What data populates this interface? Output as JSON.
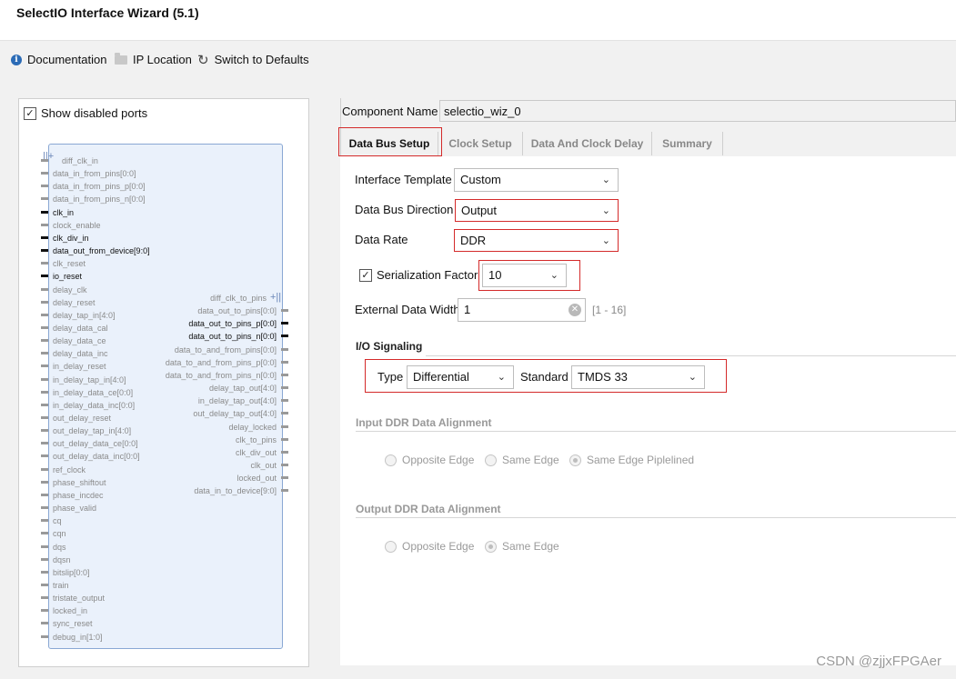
{
  "window": {
    "title": "SelectIO Interface Wizard (5.1)"
  },
  "toolbar": {
    "documentation": "Documentation",
    "ip_location": "IP Location",
    "switch_defaults": "Switch to Defaults"
  },
  "left": {
    "show_disabled_ports": "Show disabled ports",
    "left_pins": [
      {
        "label": "diff_clk_in",
        "active": false
      },
      {
        "label": "data_in_from_pins[0:0]",
        "active": false
      },
      {
        "label": "data_in_from_pins_p[0:0]",
        "active": false
      },
      {
        "label": "data_in_from_pins_n[0:0]",
        "active": false
      },
      {
        "label": "clk_in",
        "active": true
      },
      {
        "label": "clock_enable",
        "active": false
      },
      {
        "label": "clk_div_in",
        "active": true
      },
      {
        "label": "data_out_from_device[9:0]",
        "active": true
      },
      {
        "label": "clk_reset",
        "active": false
      },
      {
        "label": "io_reset",
        "active": true
      },
      {
        "label": "delay_clk",
        "active": false
      },
      {
        "label": "delay_reset",
        "active": false
      },
      {
        "label": "delay_tap_in[4:0]",
        "active": false
      },
      {
        "label": "delay_data_cal",
        "active": false
      },
      {
        "label": "delay_data_ce",
        "active": false
      },
      {
        "label": "delay_data_inc",
        "active": false
      },
      {
        "label": "in_delay_reset",
        "active": false
      },
      {
        "label": "in_delay_tap_in[4:0]",
        "active": false
      },
      {
        "label": "in_delay_data_ce[0:0]",
        "active": false
      },
      {
        "label": "in_delay_data_inc[0:0]",
        "active": false
      },
      {
        "label": "out_delay_reset",
        "active": false
      },
      {
        "label": "out_delay_tap_in[4:0]",
        "active": false
      },
      {
        "label": "out_delay_data_ce[0:0]",
        "active": false
      },
      {
        "label": "out_delay_data_inc[0:0]",
        "active": false
      },
      {
        "label": "ref_clock",
        "active": false
      },
      {
        "label": "phase_shiftout",
        "active": false
      },
      {
        "label": "phase_incdec",
        "active": false
      },
      {
        "label": "phase_valid",
        "active": false
      },
      {
        "label": "cq",
        "active": false
      },
      {
        "label": "cqn",
        "active": false
      },
      {
        "label": "dqs",
        "active": false
      },
      {
        "label": "dqsn",
        "active": false
      },
      {
        "label": "bitslip[0:0]",
        "active": false
      },
      {
        "label": "train",
        "active": false
      },
      {
        "label": "tristate_output",
        "active": false
      },
      {
        "label": "locked_in",
        "active": false
      },
      {
        "label": "sync_reset",
        "active": false
      },
      {
        "label": "debug_in[1:0]",
        "active": false
      }
    ],
    "right_pins": [
      {
        "label": "diff_clk_to_pins",
        "active": false
      },
      {
        "label": "data_out_to_pins[0:0]",
        "active": false
      },
      {
        "label": "data_out_to_pins_p[0:0]",
        "active": true
      },
      {
        "label": "data_out_to_pins_n[0:0]",
        "active": true
      },
      {
        "label": "data_to_and_from_pins[0:0]",
        "active": false
      },
      {
        "label": "data_to_and_from_pins_p[0:0]",
        "active": false
      },
      {
        "label": "data_to_and_from_pins_n[0:0]",
        "active": false
      },
      {
        "label": "delay_tap_out[4:0]",
        "active": false
      },
      {
        "label": "in_delay_tap_out[4:0]",
        "active": false
      },
      {
        "label": "out_delay_tap_out[4:0]",
        "active": false
      },
      {
        "label": "delay_locked",
        "active": false
      },
      {
        "label": "clk_to_pins",
        "active": false
      },
      {
        "label": "clk_div_out",
        "active": false
      },
      {
        "label": "clk_out",
        "active": false
      },
      {
        "label": "locked_out",
        "active": false
      },
      {
        "label": "data_in_to_device[9:0]",
        "active": false
      }
    ]
  },
  "component": {
    "label": "Component Name",
    "value": "selectio_wiz_0"
  },
  "tabs": [
    "Data Bus Setup",
    "Clock Setup",
    "Data And Clock Delay",
    "Summary"
  ],
  "form": {
    "interface_template": {
      "label": "Interface Template",
      "value": "Custom"
    },
    "data_bus_direction": {
      "label": "Data Bus Direction",
      "value": "Output"
    },
    "data_rate": {
      "label": "Data Rate",
      "value": "DDR"
    },
    "serialization": {
      "label": "Serialization Factor",
      "value": "10",
      "checked": true
    },
    "external_width": {
      "label": "External Data Width",
      "value": "1",
      "range": "[1 - 16]"
    },
    "io_signaling": {
      "title": "I/O Signaling",
      "type_label": "Type",
      "type_value": "Differential",
      "standard_label": "Standard",
      "standard_value": "TMDS 33"
    },
    "input_ddr": {
      "title": "Input DDR Data Alignment",
      "options": [
        "Opposite Edge",
        "Same Edge",
        "Same Edge Piplelined"
      ],
      "selected": "Same Edge Piplelined"
    },
    "output_ddr": {
      "title": "Output DDR Data Alignment",
      "options": [
        "Opposite Edge",
        "Same Edge"
      ],
      "selected": "Same Edge"
    }
  },
  "watermark": "CSDN @zjjxFPGAer",
  "colors": {
    "highlight_box": "#d42a2a",
    "symbol_fill": "#eaf1fb",
    "info_icon": "#2b6bb6"
  }
}
